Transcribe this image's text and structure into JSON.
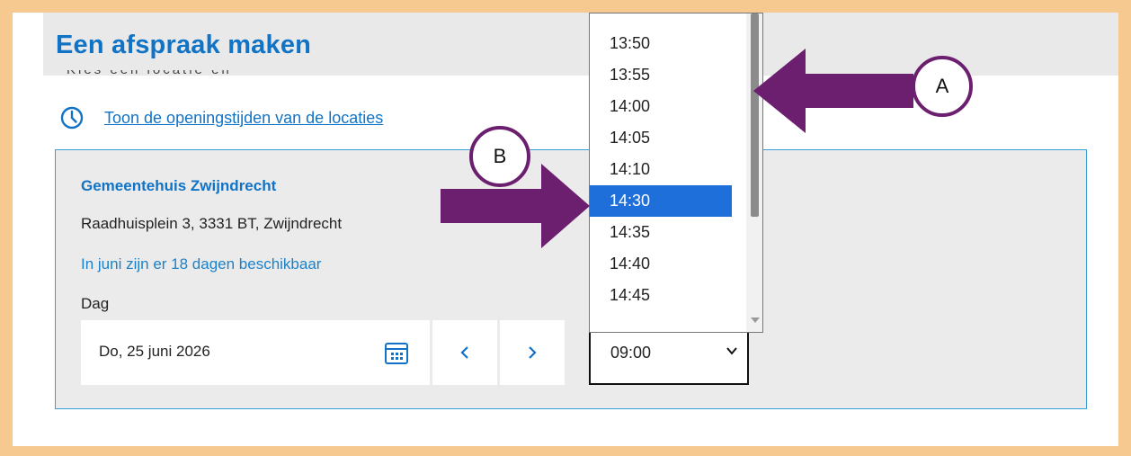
{
  "page": {
    "title": "Een afspraak maken",
    "hours_link": "Toon de openingstijden van de locaties"
  },
  "location": {
    "name": "Gemeentehuis Zwijndrecht",
    "address": "Raadhuisplein 3, 3331 BT, Zwijndrecht",
    "availability": "In juni zijn er 18 dagen beschikbaar"
  },
  "day_picker": {
    "label": "Dag",
    "value": "Do, 25 juni 2026",
    "prev_symbol": "‹",
    "next_symbol": "›"
  },
  "time_select": {
    "value": "09:00",
    "options_visible": [
      "13:50",
      "13:55",
      "14:00",
      "14:05",
      "14:10",
      "14:30",
      "14:35",
      "14:40",
      "14:45"
    ],
    "highlighted": "14:30"
  },
  "annotations": {
    "a_label": "A",
    "b_label": "B"
  },
  "colors": {
    "accent": "#1173c6",
    "highlight": "#1e6fd9",
    "annotation": "#6b1f6e",
    "frame": "#f5c98f"
  }
}
